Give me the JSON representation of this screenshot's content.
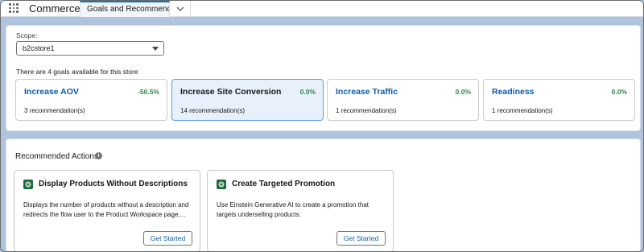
{
  "topbar": {
    "app_name": "Commerce",
    "tab_label": "Goals and Recommendati..."
  },
  "scope": {
    "label": "Scope:",
    "selected": "b2cstore1",
    "goals_count_text": "There are 4 goals available for this store"
  },
  "goals": [
    {
      "title": "Increase AOV",
      "percent": "-50.5%",
      "recommendations": "3 recommendation(s)"
    },
    {
      "title": "Increase Site Conversion",
      "percent": "0.0%",
      "recommendations": "14 recommendation(s)"
    },
    {
      "title": "Increase Traffic",
      "percent": "0.0%",
      "recommendations": "1 recommendation(s)"
    },
    {
      "title": "Readiness",
      "percent": "0.0%",
      "recommendations": "1 recommendation(s)"
    }
  ],
  "recommended_actions": {
    "title": "Recommended Actions",
    "info_glyph": "i",
    "items": [
      {
        "title": "Display Products Without Descriptions",
        "description": "Displays the number of products without a description and redirects the flow user to the Product Workspace page....",
        "button_label": "Get Started"
      },
      {
        "title": "Create Targeted Promotion",
        "description": "Use Einstein Generative AI to create a promotion that targets underselling products.",
        "button_label": "Get Started"
      }
    ]
  },
  "colors": {
    "brand_blue": "#0176d3",
    "link_blue": "#0b5cab",
    "positive_green": "#2e844a",
    "action_icon_green": "#1d6b3a",
    "background": "#b0c4df"
  },
  "icons": [
    "app-launcher-icon",
    "chevron-down-icon",
    "info-icon",
    "gear-icon"
  ]
}
